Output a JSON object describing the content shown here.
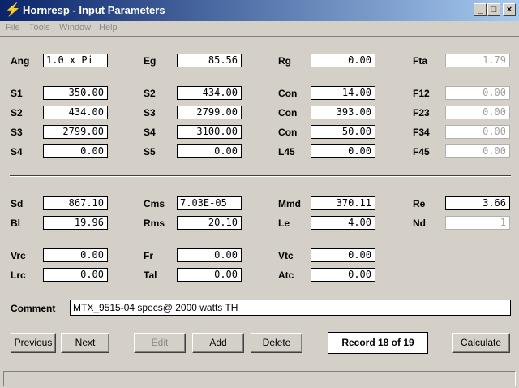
{
  "window": {
    "title": "Hornresp - Input Parameters",
    "min": "_",
    "max": "□",
    "close": "×"
  },
  "menu": [
    "File",
    "Tools",
    "Window",
    "Help"
  ],
  "params": {
    "Ang": {
      "label": "Ang",
      "value": "1.0 x Pi"
    },
    "Eg": {
      "label": "Eg",
      "value": "85.56"
    },
    "Rg": {
      "label": "Rg",
      "value": "0.00"
    },
    "Fta": {
      "label": "Fta",
      "value": "1.79"
    },
    "S1a": {
      "label": "S1",
      "value": "350.00"
    },
    "S2a": {
      "label": "S2",
      "value": "434.00"
    },
    "Con1": {
      "label": "Con",
      "value": "14.00"
    },
    "F12": {
      "label": "F12",
      "value": "0.00"
    },
    "S2b": {
      "label": "S2",
      "value": "434.00"
    },
    "S3a": {
      "label": "S3",
      "value": "2799.00"
    },
    "Con2": {
      "label": "Con",
      "value": "393.00"
    },
    "F23": {
      "label": "F23",
      "value": "0.00"
    },
    "S3b": {
      "label": "S3",
      "value": "2799.00"
    },
    "S4a": {
      "label": "S4",
      "value": "3100.00"
    },
    "Con3": {
      "label": "Con",
      "value": "50.00"
    },
    "F34": {
      "label": "F34",
      "value": "0.00"
    },
    "S4b": {
      "label": "S4",
      "value": "0.00"
    },
    "S5": {
      "label": "S5",
      "value": "0.00"
    },
    "L45": {
      "label": "L45",
      "value": "0.00"
    },
    "F45": {
      "label": "F45",
      "value": "0.00"
    },
    "Sd": {
      "label": "Sd",
      "value": "867.10"
    },
    "Cms": {
      "label": "Cms",
      "value": "7.03E-05"
    },
    "Mmd": {
      "label": "Mmd",
      "value": "370.11"
    },
    "Re": {
      "label": "Re",
      "value": "3.66"
    },
    "Bl": {
      "label": "Bl",
      "value": "19.96"
    },
    "Rms": {
      "label": "Rms",
      "value": "20.10"
    },
    "Le": {
      "label": "Le",
      "value": "4.00"
    },
    "Nd": {
      "label": "Nd",
      "value": "1"
    },
    "Vrc": {
      "label": "Vrc",
      "value": "0.00"
    },
    "Fr": {
      "label": "Fr",
      "value": "0.00"
    },
    "Vtc": {
      "label": "Vtc",
      "value": "0.00"
    },
    "Lrc": {
      "label": "Lrc",
      "value": "0.00"
    },
    "Tal": {
      "label": "Tal",
      "value": "0.00"
    },
    "Atc": {
      "label": "Atc",
      "value": "0.00"
    }
  },
  "comment": {
    "label": "Comment",
    "value": "MTX_9515-04 specs@ 2000 watts TH"
  },
  "buttons": {
    "previous": "Previous",
    "next": "Next",
    "edit": "Edit",
    "add": "Add",
    "delete": "Delete",
    "calculate": "Calculate"
  },
  "record": "Record 18 of 19"
}
